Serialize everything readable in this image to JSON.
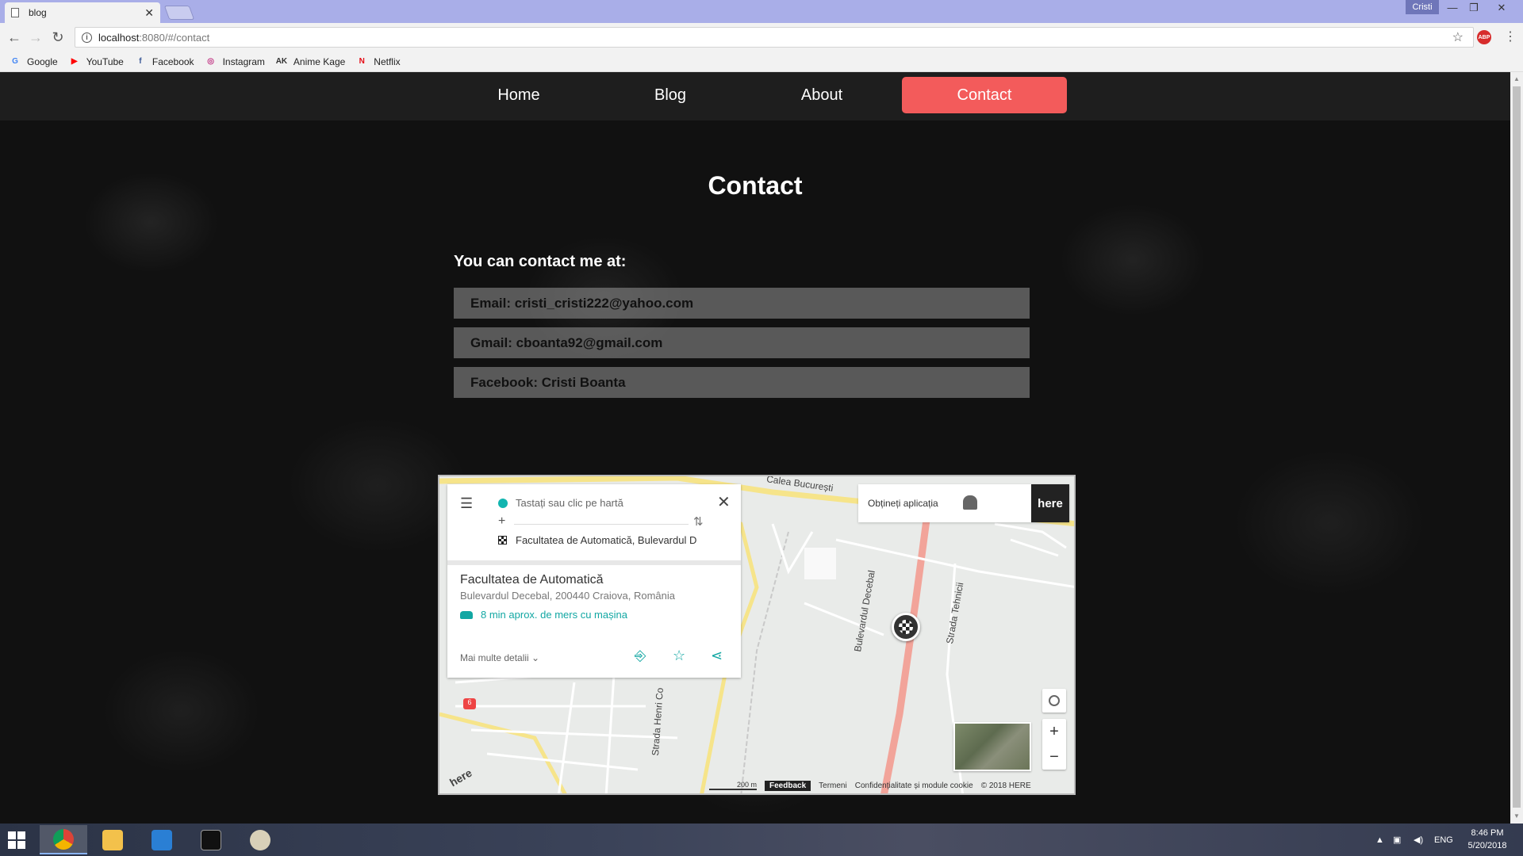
{
  "browser": {
    "tab_title": "blog",
    "tab_close": "✕",
    "user": "Cristi",
    "window_controls": {
      "minimize": "—",
      "restore": "❐",
      "close": "✕"
    },
    "url_host": "localhost",
    "url_path": ":8080/#/contact",
    "bookmarks": [
      {
        "label": "Google",
        "icon": "G",
        "color": "#4285f4"
      },
      {
        "label": "YouTube",
        "icon": "▶",
        "color": "#ff0000"
      },
      {
        "label": "Facebook",
        "icon": "f",
        "color": "#3b5998"
      },
      {
        "label": "Instagram",
        "icon": "◎",
        "color": "#c13584"
      },
      {
        "label": "Anime Kage",
        "icon": "AK",
        "color": "#333333"
      },
      {
        "label": "Netflix",
        "icon": "N",
        "color": "#e50914"
      }
    ]
  },
  "site_nav": {
    "items": [
      {
        "label": "Home",
        "active": false
      },
      {
        "label": "Blog",
        "active": false
      },
      {
        "label": "About",
        "active": false
      },
      {
        "label": "Contact",
        "active": true
      }
    ],
    "accent": "#f35b5b"
  },
  "contact": {
    "title": "Contact",
    "intro": "You can contact me at:",
    "items": [
      "Email: cristi_cristi222@yahoo.com",
      "Gmail: cboanta92@gmail.com",
      "Facebook: Cristi Boanta"
    ]
  },
  "map": {
    "route_from_placeholder": "Tastați sau clic pe hartă",
    "route_to": "Facultatea de Automatică, Bulevardul Decebal",
    "place_name": "Facultatea de Automatică",
    "place_address": "Bulevardul Decebal, 200440 Craiova, România",
    "drive_time": "8 min aprox. de mers cu mașina",
    "more_details": "Mai multe detalii ⌄",
    "get_app": "Obțineți aplicația",
    "here_logo": "here",
    "street_labels": [
      "Calea București",
      "Bulevardul Decebal",
      "Strada Tehnicii",
      "Strada Henri Co",
      "6"
    ],
    "scale": "200 m",
    "feedback": "Feedback",
    "terms": "Termeni",
    "privacy": "Confidențialitate și module cookie",
    "copyright": "© 2018 HERE",
    "zoom_in": "+",
    "zoom_out": "−"
  },
  "taskbar": {
    "lang": "ENG",
    "time": "8:46 PM",
    "date": "5/20/2018"
  }
}
